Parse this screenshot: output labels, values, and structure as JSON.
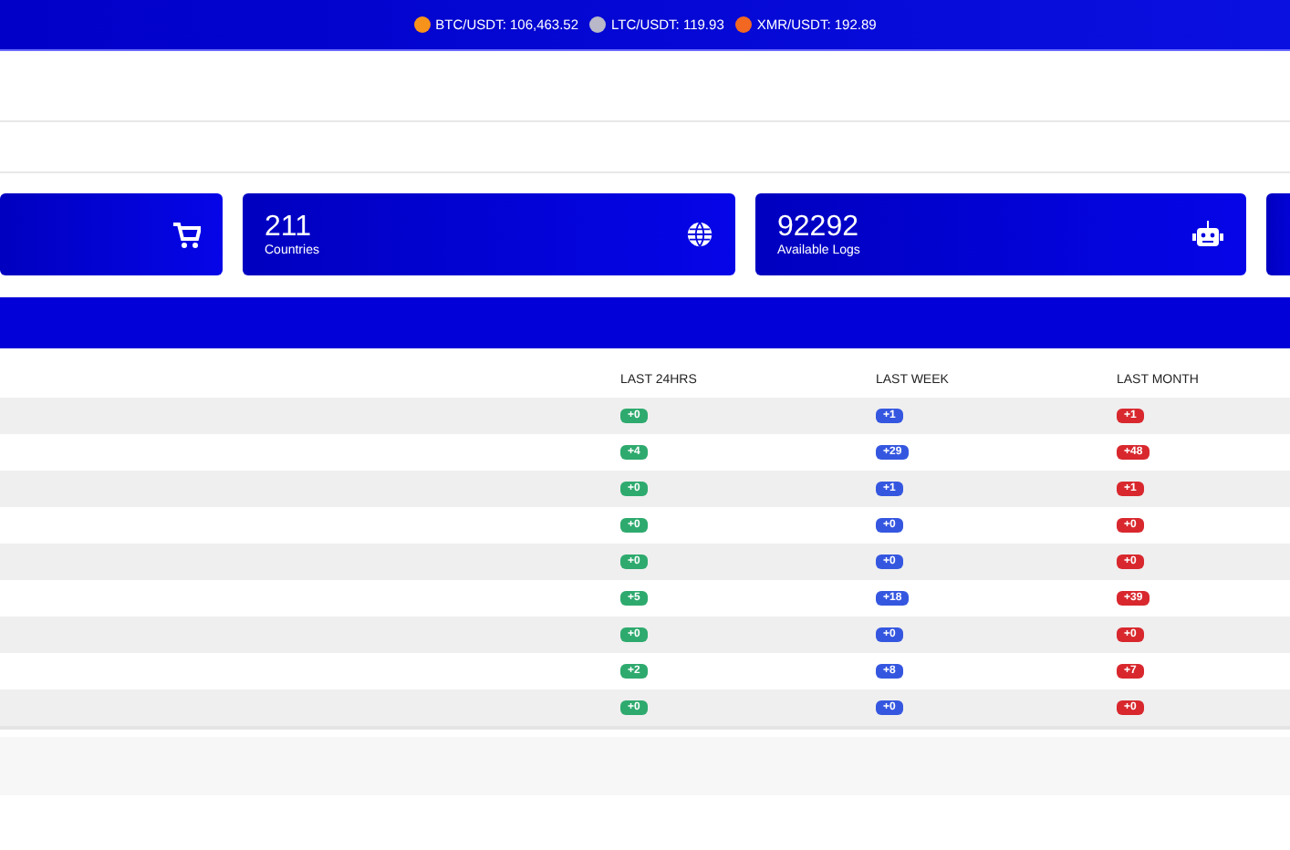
{
  "ticker": [
    {
      "kind": "btc",
      "label": "BTC/USDT: 106,463.52"
    },
    {
      "kind": "ltc",
      "label": "LTC/USDT: 119.93"
    },
    {
      "kind": "xmr",
      "label": "XMR/USDT: 192.89"
    }
  ],
  "cards": [
    {
      "kind": "cart"
    },
    {
      "kind": "globe",
      "value": "211",
      "label": "Countries"
    },
    {
      "kind": "robot",
      "value": "92292",
      "label": "Available Logs"
    },
    {
      "kind": "blank"
    }
  ],
  "table": {
    "columns": [
      "LAST 24HRS",
      "LAST WEEK",
      "LAST MONTH"
    ],
    "rows": [
      [
        "+0",
        "+1",
        "+1"
      ],
      [
        "+4",
        "+29",
        "+48"
      ],
      [
        "+0",
        "+1",
        "+1"
      ],
      [
        "+0",
        "+0",
        "+0"
      ],
      [
        "+0",
        "+0",
        "+0"
      ],
      [
        "+5",
        "+18",
        "+39"
      ],
      [
        "+0",
        "+0",
        "+0"
      ],
      [
        "+2",
        "+8",
        "+7"
      ],
      [
        "+0",
        "+0",
        "+0"
      ]
    ]
  }
}
